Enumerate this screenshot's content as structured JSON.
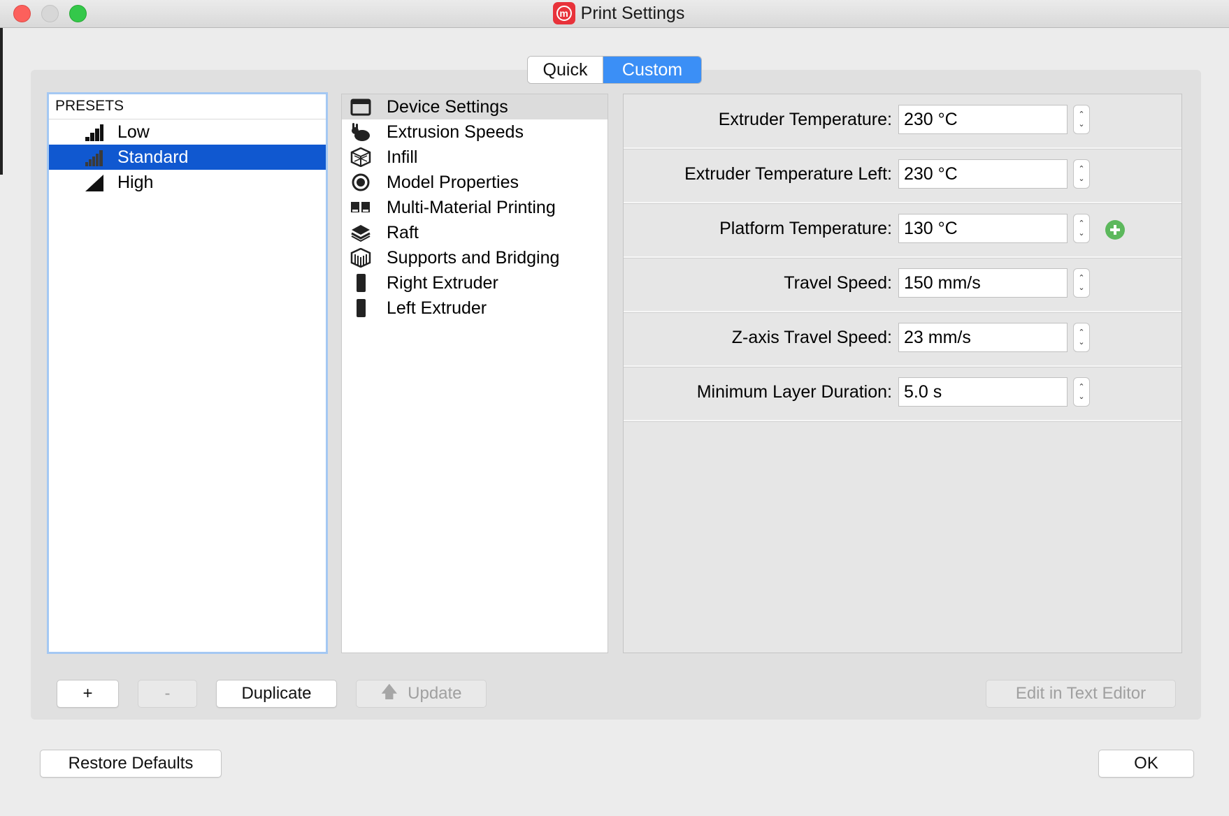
{
  "window": {
    "title": "Print Settings",
    "app_icon_glyph": "m"
  },
  "mode_tabs": {
    "quick": "Quick",
    "custom": "Custom",
    "selected": "Custom"
  },
  "presets": {
    "header": "PRESETS",
    "items": [
      {
        "label": "Low",
        "icon": "quality-low-icon"
      },
      {
        "label": "Standard",
        "icon": "quality-standard-icon"
      },
      {
        "label": "High",
        "icon": "quality-high-icon"
      }
    ],
    "selected": "Standard"
  },
  "categories": {
    "items": [
      {
        "label": "Device Settings",
        "icon": "device-settings-icon"
      },
      {
        "label": "Extrusion Speeds",
        "icon": "rabbit-icon"
      },
      {
        "label": "Infill",
        "icon": "infill-cube-icon"
      },
      {
        "label": "Model Properties",
        "icon": "model-properties-icon"
      },
      {
        "label": "Multi-Material Printing",
        "icon": "multi-material-icon"
      },
      {
        "label": "Raft",
        "icon": "raft-layers-icon"
      },
      {
        "label": "Supports and Bridging",
        "icon": "supports-icon"
      },
      {
        "label": "Right Extruder",
        "icon": "extruder-icon"
      },
      {
        "label": "Left Extruder",
        "icon": "extruder-icon"
      }
    ],
    "selected": "Device Settings"
  },
  "settings": [
    {
      "label": "Extruder Temperature:",
      "value": "230 °C"
    },
    {
      "label": "Extruder Temperature Left:",
      "value": "230 °C"
    },
    {
      "label": "Platform Temperature:",
      "value": "130 °C",
      "has_add_badge": true
    },
    {
      "label": "Travel Speed:",
      "value": "150 mm/s"
    },
    {
      "label": "Z-axis Travel Speed:",
      "value": "23 mm/s"
    },
    {
      "label": "Minimum Layer Duration:",
      "value": "5.0 s"
    }
  ],
  "buttons": {
    "add": "+",
    "remove": "-",
    "duplicate": "Duplicate",
    "update": "Update",
    "edit_text": "Edit in Text Editor",
    "restore": "Restore Defaults",
    "ok": "OK"
  },
  "colors": {
    "accent": "#3b8ff6",
    "selection": "#1058d0",
    "close": "#fc605c",
    "maximize": "#34c84a",
    "app_icon": "#e8323a",
    "add_badge": "#5cb85c"
  }
}
